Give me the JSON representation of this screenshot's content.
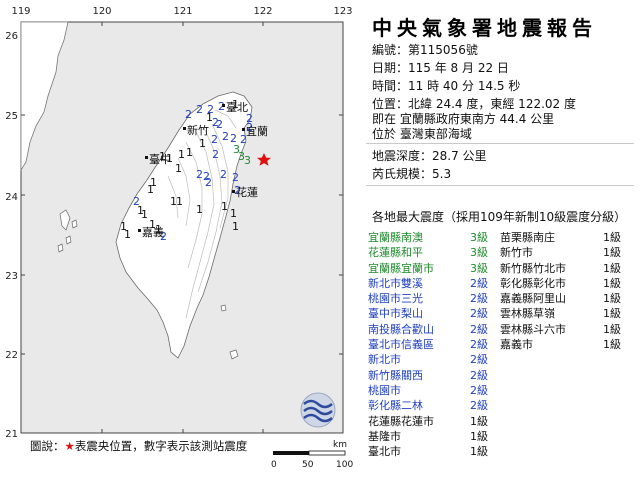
{
  "report": {
    "title": "中央氣象署地震報告",
    "number_label": "編號：",
    "number_value": "第115056號",
    "date_label": "日期：",
    "date_value": "115 年 8 月 22 日",
    "time_label": "時間：",
    "time_value": "11 時 40 分 14.5 秒",
    "position_label": "位置：",
    "position_value": "北緯 24.4 度，東經 122.02 度",
    "location_line1": "即在 宜蘭縣政府東南方 44.4 公里",
    "location_line2": "位於 臺灣東部海域",
    "depth_label": "地震深度：",
    "depth_value": "28.7 公里",
    "magnitude_label": "芮氏規模：",
    "magnitude_value": "5.3",
    "intensity_header": "各地最大震度（採用109年新制10級震度分級）"
  },
  "intensity_left": [
    {
      "name": "宜蘭縣南澳",
      "level": "3級",
      "color": "#1e8a2e"
    },
    {
      "name": "花蓮縣和平",
      "level": "3級",
      "color": "#1e8a2e"
    },
    {
      "name": "宜蘭縣宜蘭市",
      "level": "3級",
      "color": "#1e8a2e"
    },
    {
      "name": "新北市雙溪",
      "level": "2級",
      "color": "#1f3fbf"
    },
    {
      "name": "桃園市三光",
      "level": "2級",
      "color": "#1f3fbf"
    },
    {
      "name": "臺中市梨山",
      "level": "2級",
      "color": "#1f3fbf"
    },
    {
      "name": "南投縣合歡山",
      "level": "2級",
      "color": "#1f3fbf"
    },
    {
      "name": "臺北市信義區",
      "level": "2級",
      "color": "#1f3fbf"
    },
    {
      "name": "新北市",
      "level": "2級",
      "color": "#1f3fbf"
    },
    {
      "name": "新竹縣關西",
      "level": "2級",
      "color": "#1f3fbf"
    },
    {
      "name": "桃園市",
      "level": "2級",
      "color": "#1f3fbf"
    },
    {
      "name": "彰化縣二林",
      "level": "2級",
      "color": "#1f3fbf"
    },
    {
      "name": "花蓮縣花蓮市",
      "level": "1級",
      "color": "#111111"
    },
    {
      "name": "基隆市",
      "level": "1級",
      "color": "#111111"
    },
    {
      "name": "臺北市",
      "level": "1級",
      "color": "#111111"
    }
  ],
  "intensity_right": [
    {
      "name": "苗栗縣南庄",
      "level": "1級",
      "color": "#111111"
    },
    {
      "name": "新竹市",
      "level": "1級",
      "color": "#111111"
    },
    {
      "name": "新竹縣竹北市",
      "level": "1級",
      "color": "#111111"
    },
    {
      "name": "彰化縣彰化市",
      "level": "1級",
      "color": "#111111"
    },
    {
      "name": "嘉義縣阿里山",
      "level": "1級",
      "color": "#111111"
    },
    {
      "name": "雲林縣草嶺",
      "level": "1級",
      "color": "#111111"
    },
    {
      "name": "雲林縣斗六市",
      "level": "1級",
      "color": "#111111"
    },
    {
      "name": "嘉義市",
      "level": "1級",
      "color": "#111111"
    }
  ],
  "map": {
    "x_ticks": [
      "119",
      "120",
      "121",
      "122",
      "123"
    ],
    "y_ticks": [
      "26",
      "25",
      "24",
      "23",
      "22",
      "21"
    ],
    "cities": [
      "臺北",
      "宜蘭",
      "新竹",
      "花蓮",
      "臺中",
      "嘉義"
    ],
    "scale_unit": "km",
    "scale_labels": [
      "0",
      "50",
      "100"
    ],
    "station_values": [
      "2",
      "2",
      "2",
      "2",
      "1",
      "1",
      "2",
      "2",
      "2",
      "2",
      "2",
      "2",
      "2",
      "2",
      "1",
      "3",
      "1",
      "1",
      "2",
      "1",
      "1",
      "1",
      "2",
      "2",
      "3",
      "3",
      "2",
      "2",
      "2",
      "2",
      "1",
      "1",
      "1",
      "1",
      "1",
      "1",
      "2",
      "1",
      "1",
      "1",
      "1",
      "2",
      "1",
      "1",
      "1",
      "1"
    ],
    "legend_prefix": "圖說：",
    "legend_star": "★",
    "legend_rest": "表震央位置，數字表示該測站震度"
  },
  "colors": {
    "land": "#ffffff",
    "sea": "#e9e9e9",
    "terrain": "#bcbcbc",
    "epicenter": "#e01010",
    "level1": "#111111",
    "level2": "#1f3fbf",
    "level3": "#1e8a2e"
  }
}
